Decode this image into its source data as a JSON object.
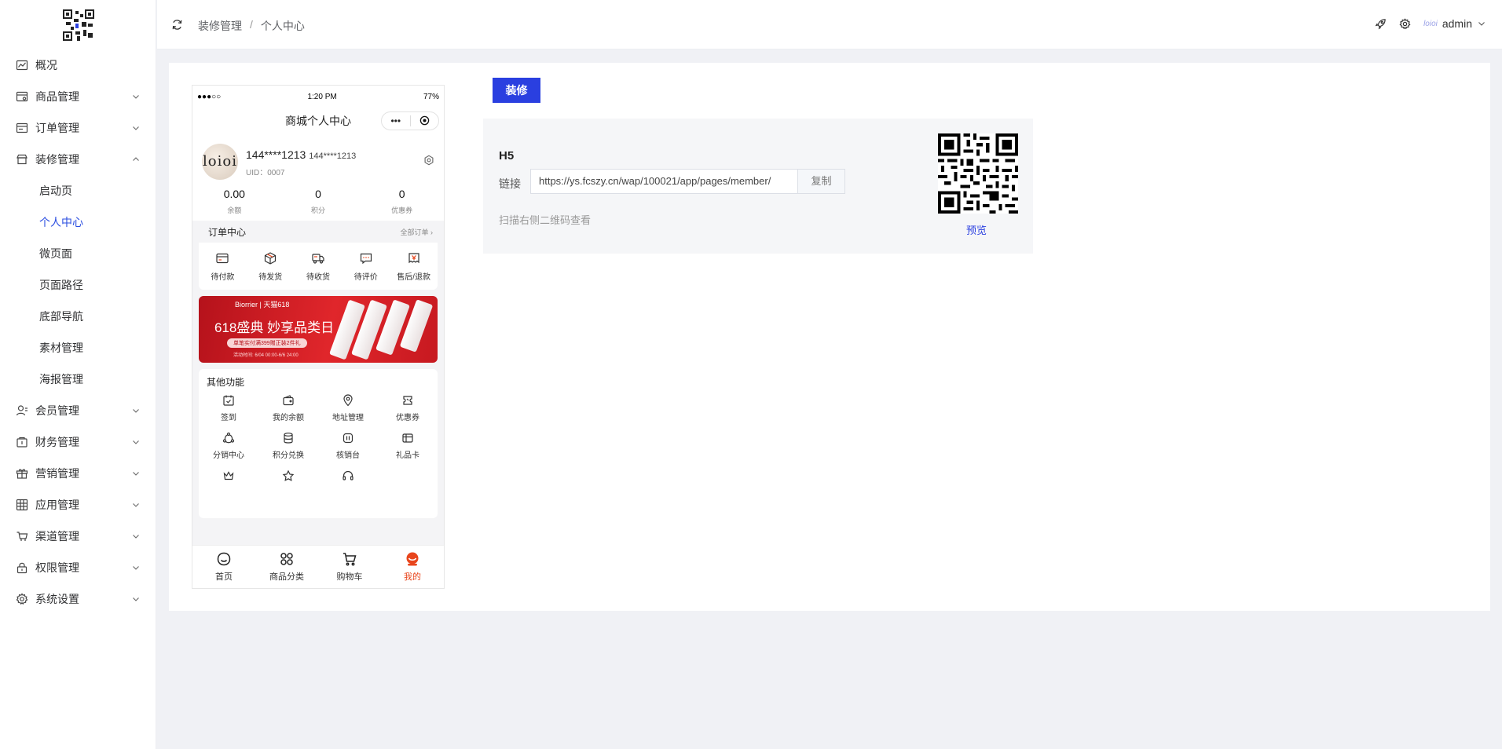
{
  "sidebar": {
    "menu": {
      "overview": "概况",
      "goods": "商品管理",
      "orders": "订单管理",
      "decor": "装修管理",
      "members": "会员管理",
      "finance": "财务管理",
      "marketing": "营销管理",
      "apps": "应用管理",
      "channels": "渠道管理",
      "permissions": "权限管理",
      "settings": "系统设置"
    },
    "decor_sub": [
      "启动页",
      "个人中心",
      "微页面",
      "页面路径",
      "底部导航",
      "素材管理",
      "海报管理"
    ],
    "active_sub": "个人中心"
  },
  "header": {
    "breadcrumb": [
      "装修管理",
      "/",
      "个人中心"
    ],
    "avatar_text": "loioi",
    "username": "admin"
  },
  "phone": {
    "status": {
      "signal": "●●●○○",
      "time": "1:20 PM",
      "battery": "77%"
    },
    "nav_title": "商城个人中心",
    "capsule_more": "•••",
    "user": {
      "avatar_text": "loioi",
      "name": "144****1213",
      "name_small": "144****1213",
      "uid": "UID：0007"
    },
    "stats": [
      {
        "value": "0.00",
        "label": "余额"
      },
      {
        "value": "0",
        "label": "积分"
      },
      {
        "value": "0",
        "label": "优惠券"
      }
    ],
    "order_center": {
      "title": "订单中心",
      "more": "全部订单 ›"
    },
    "orders": [
      "待付款",
      "待发货",
      "待收货",
      "待评价",
      "售后/退款"
    ],
    "banner": {
      "brand": "Biorrier  |  天猫618",
      "headline": "618盛典 妙享品类日",
      "offer": "单笔实付满399赠正装2件礼",
      "time": "活动时间: 6/04 00:00-6/6 24:00"
    },
    "other_title": "其他功能",
    "other_items": [
      "签到",
      "我的余额",
      "地址管理",
      "优惠券",
      "分销中心",
      "积分兑换",
      "核销台",
      "礼品卡"
    ],
    "tabbar": [
      "首页",
      "商品分类",
      "购物车",
      "我的"
    ]
  },
  "panel": {
    "edit_button": "装修",
    "h5_title": "H5",
    "link_label": "链接",
    "link_value": "https://ys.fcszy.cn/wap/100021/app/pages/member/",
    "copy_button": "复制",
    "hint": "扫描右侧二维码查看",
    "preview_link": "预览"
  },
  "colors": {
    "primary": "#2a3fe0",
    "active_menu": "#2a4de0",
    "tab_active": "#e8451c",
    "banner_red": "#d81f26"
  }
}
